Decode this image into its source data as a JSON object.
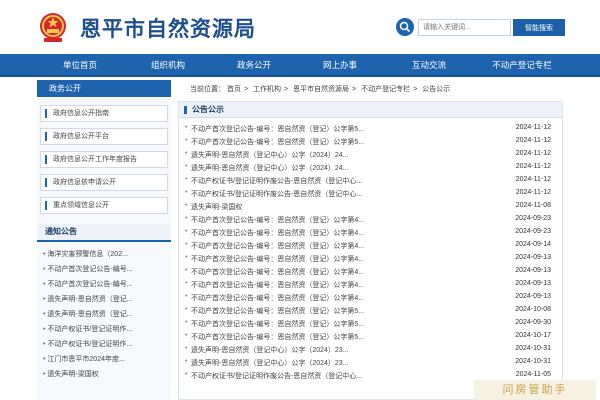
{
  "header": {
    "title": "恩平市自然资源局",
    "search": {
      "placeholder": "请输入关键词...",
      "button_label": "智能搜索"
    },
    "emblem_icon": "national-emblem-icon",
    "search_icon": "magnifier-icon"
  },
  "nav": {
    "items": [
      "单位首页",
      "组织机构",
      "政务公开",
      "网上办事",
      "互动交流",
      "不动产登记专栏"
    ]
  },
  "sidebar": {
    "section_title": "政务公开",
    "links": [
      "政府信息公开指南",
      "政府信息公开平台",
      "政府信息公开工作年度报告",
      "政府信息依申请公开",
      "重点领域信息公开"
    ],
    "notice_title": "通知公告",
    "notices": [
      "海洋灾害预警信息（202...",
      "不动产首次登记公告-编号...",
      "不动产首次登记公告-编号...",
      "遗失声明-恩自然资（登记...",
      "遗失声明-恩自然资（登记...",
      "不动产权证书/登记证明作...",
      "不动产权证书/登记证明作...",
      "江门市恩平市2024年度...",
      "遗失声明-梁国权"
    ]
  },
  "breadcrumb": {
    "label": "当前位置：",
    "items": [
      "首页",
      "工作机构",
      "恩平市自然资源局",
      "不动产登记专栏",
      "公告公示"
    ],
    "sep": ">"
  },
  "main": {
    "title": "公告公示",
    "rows": [
      {
        "title": "不动产首次登记公告-编号：恩自然资（登记）公字第5...",
        "date": "2024-11-12"
      },
      {
        "title": "不动产首次登记公告-编号：恩自然资（登记）公字第5...",
        "date": "2024-11-12"
      },
      {
        "title": "遗失声明-恩自然资（登记中心）公字（2024）24...",
        "date": "2024-11-12"
      },
      {
        "title": "遗失声明-恩自然资（登记中心）公字（2024）24...",
        "date": "2024-11-12"
      },
      {
        "title": "不动产权证书/登记证明作废公告-恩自然资（登记中心...",
        "date": "2024-11-12"
      },
      {
        "title": "不动产权证书/登记证明作废公告-恩自然资（登记中心...",
        "date": "2024-11-12"
      },
      {
        "title": "遗失声明-梁国权",
        "date": "2024-11-08"
      },
      {
        "title": "不动产首次登记公告-编号：恩自然资（登记）公字第4...",
        "date": "2024-09-23"
      },
      {
        "title": "不动产首次登记公告-编号：恩自然资（登记）公字第4...",
        "date": "2024-09-23"
      },
      {
        "title": "不动产首次登记公告-编号：恩自然资（登记）公字第4...",
        "date": "2024-09-14"
      },
      {
        "title": "不动产首次登记公告-编号：恩自然资（登记）公字第4...",
        "date": "2024-09-13"
      },
      {
        "title": "不动产首次登记公告-编号：恩自然资（登记）公字第4...",
        "date": "2024-09-13"
      },
      {
        "title": "不动产首次登记公告-编号：恩自然资（登记）公字第4...",
        "date": "2024-09-13"
      },
      {
        "title": "不动产首次登记公告-编号：恩自然资（登记）公字第4...",
        "date": "2024-09-13"
      },
      {
        "title": "不动产首次登记公告-编号：恩自然资（登记）公字第5...",
        "date": "2024-10-08"
      },
      {
        "title": "不动产首次登记公告-编号：恩自然资（登记）公字第5...",
        "date": "2024-09-30"
      },
      {
        "title": "不动产首次登记公告-编号：恩自然资（登记）公字第5...",
        "date": "2024-10-17"
      },
      {
        "title": "遗失声明-恩自然资（登记中心）公字（2024）23...",
        "date": "2024-10-31"
      },
      {
        "title": "遗失声明-恩自然资（登记中心）公字（2024）23...",
        "date": "2024-10-31"
      },
      {
        "title": "不动产权证书/登记证明作废公告-恩自然资（登记中心...",
        "date": "2024-11-05"
      }
    ]
  },
  "watermark": "问房管助手",
  "colors": {
    "primary": "#1e63ae",
    "title": "#1c4f8f"
  }
}
